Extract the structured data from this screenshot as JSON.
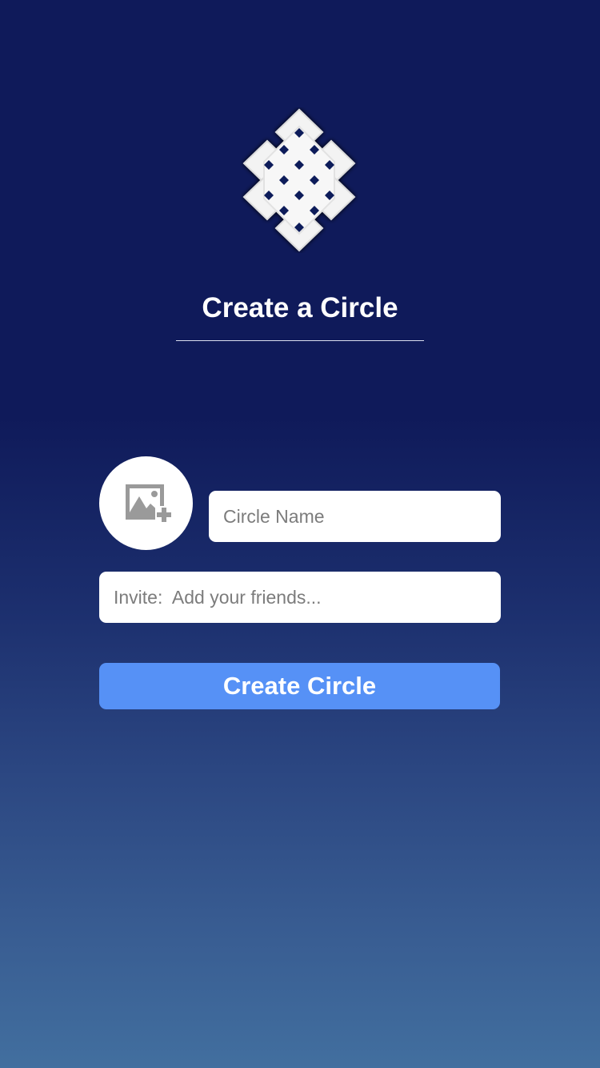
{
  "logo": {
    "icon": "endless-knot-icon"
  },
  "header": {
    "title": "Create a Circle"
  },
  "form": {
    "photo_icon": "add-photo-icon",
    "circle_name_placeholder": "Circle Name",
    "circle_name_value": "",
    "invite_placeholder": "Invite:  Add your friends...",
    "invite_value": "",
    "submit_label": "Create Circle"
  },
  "colors": {
    "background_top": "#0f1a5a",
    "background_bottom": "#426f9f",
    "button": "#5691f6",
    "field_background": "#ffffff",
    "placeholder_text": "#7c7c7c",
    "photo_icon": "#9a9a9a"
  }
}
